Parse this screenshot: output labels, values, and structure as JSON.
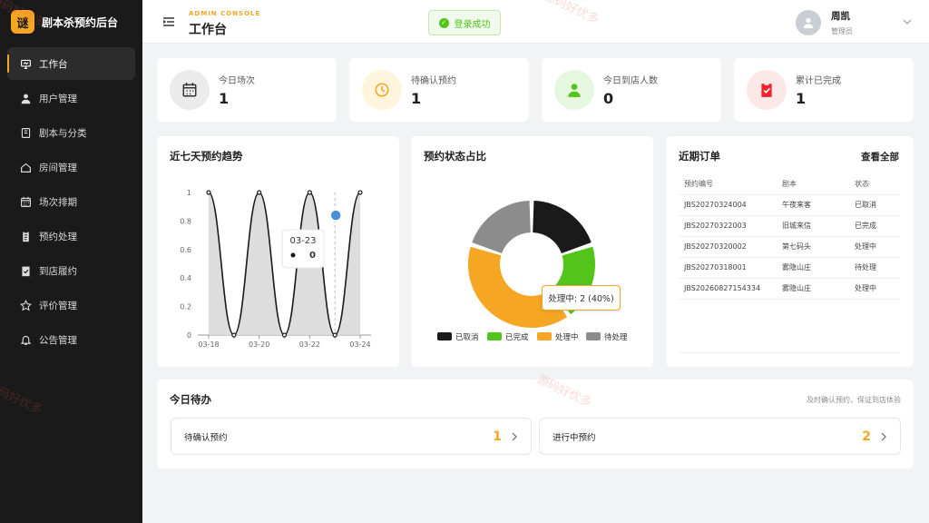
{
  "brand": {
    "logo_char": "谜",
    "name": "剧本杀预约后台",
    "accent": "#f5a623"
  },
  "sidebar": {
    "items": [
      {
        "label": "工作台",
        "icon": "monitor-icon",
        "active": true
      },
      {
        "label": "用户管理",
        "icon": "user-icon"
      },
      {
        "label": "剧本与分类",
        "icon": "book-icon"
      },
      {
        "label": "房间管理",
        "icon": "home-icon"
      },
      {
        "label": "场次排期",
        "icon": "calendar-icon"
      },
      {
        "label": "预约处理",
        "icon": "clipboard-icon"
      },
      {
        "label": "到店履约",
        "icon": "check-clipboard-icon"
      },
      {
        "label": "评价管理",
        "icon": "star-icon"
      },
      {
        "label": "公告管理",
        "icon": "bell-icon"
      }
    ]
  },
  "header": {
    "console_label": "ADMIN CONSOLE",
    "title": "工作台",
    "toast": "登录成功",
    "user_name": "周凯",
    "user_role": "管理员"
  },
  "stats": [
    {
      "label": "今日场次",
      "value": "1",
      "icon": "calendar-icon",
      "bg": "#ebebeb",
      "fg": "#333333"
    },
    {
      "label": "待确认预约",
      "value": "1",
      "icon": "clock-icon",
      "bg": "#fff4dc",
      "fg": "#f5a623"
    },
    {
      "label": "今日到店人数",
      "value": "0",
      "icon": "user-icon",
      "bg": "#e6f7e0",
      "fg": "#52c41a"
    },
    {
      "label": "累计已完成",
      "value": "1",
      "icon": "check-clipboard-icon",
      "bg": "#fde8e8",
      "fg": "#f5222d"
    }
  ],
  "trend": {
    "title": "近七天预约趋势",
    "tooltip_date": "03-23",
    "tooltip_value": "0"
  },
  "status": {
    "title": "预约状态占比",
    "tooltip": "处理中: 2 (40%)"
  },
  "chart_data": [
    {
      "type": "area",
      "title": "近七天预约趋势",
      "x": [
        "03-18",
        "03-19",
        "03-20",
        "03-21",
        "03-22",
        "03-23",
        "03-24"
      ],
      "x_ticks": [
        "03-18",
        "03-20",
        "03-22",
        "03-24"
      ],
      "y_ticks": [
        "0",
        "0.2",
        "0.4",
        "0.6",
        "0.8",
        "1"
      ],
      "ylim": [
        0,
        1
      ],
      "series": [
        {
          "values": [
            1,
            0,
            1,
            0,
            1,
            0,
            1
          ]
        }
      ],
      "smooth": true,
      "grid": false,
      "highlight_index": 5,
      "colors": {
        "line": "#1a1a1a",
        "area": "#d9d9d9",
        "highlight": "#4a90d9"
      }
    },
    {
      "type": "pie",
      "title": "预约状态占比",
      "categories": [
        "已取消",
        "已完成",
        "处理中",
        "待处理"
      ],
      "values": [
        1,
        1,
        2,
        1
      ],
      "donut": true,
      "legend": "bottom",
      "colors": [
        "#1a1a1a",
        "#52c41a",
        "#f5a623",
        "#8c8c8c"
      ]
    }
  ],
  "orders": {
    "title": "近期订单",
    "view_all": "查看全部",
    "columns": [
      "预约编号",
      "剧本",
      "状态"
    ],
    "rows": [
      [
        "JBS20270324004",
        "午夜来客",
        "已取消"
      ],
      [
        "JBS20270322003",
        "旧城来信",
        "已完成"
      ],
      [
        "JBS20270320002",
        "第七码头",
        "处理中"
      ],
      [
        "JBS20270318001",
        "雾隐山庄",
        "待处理"
      ],
      [
        "JBS20260827154334",
        "雾隐山庄",
        "处理中"
      ]
    ]
  },
  "todo": {
    "title": "今日待办",
    "hint": "及时确认预约，保证到店体验",
    "items": [
      {
        "label": "待确认预约",
        "count": "1"
      },
      {
        "label": "进行中预约",
        "count": "2"
      }
    ]
  },
  "watermark": "源码好优多"
}
